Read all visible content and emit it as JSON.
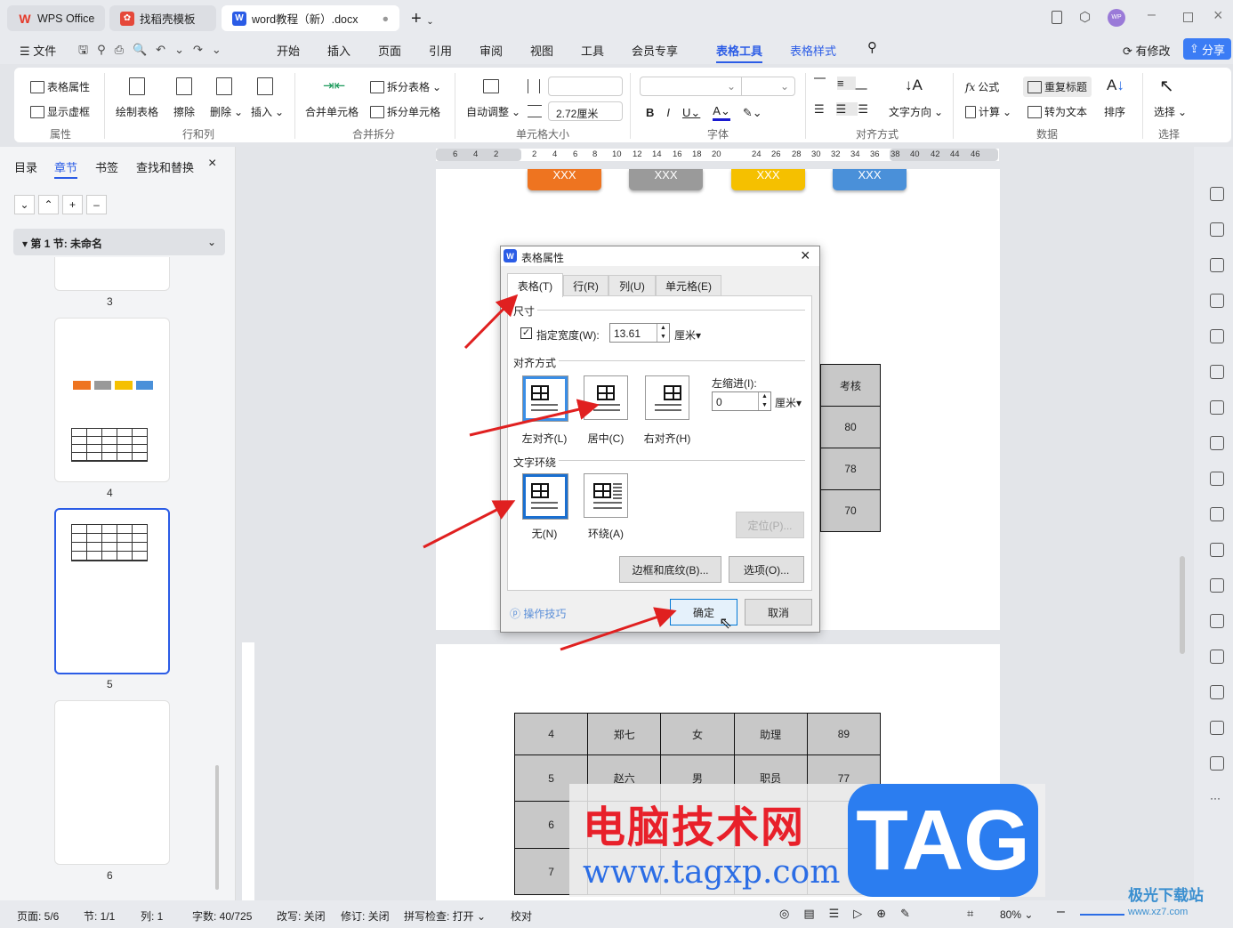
{
  "tabs": [
    {
      "label": "WPS Office"
    },
    {
      "label": "找稻壳模板"
    },
    {
      "label": "word教程（新）.docx"
    }
  ],
  "menu": {
    "file": "文件",
    "items": [
      "开始",
      "插入",
      "页面",
      "引用",
      "审阅",
      "视图",
      "工具",
      "会员专享",
      "表格工具",
      "表格样式"
    ],
    "active": "表格工具",
    "modified": "有修改",
    "share": "分享",
    "avatar": "WP"
  },
  "ribbon": {
    "table_props": "表格属性",
    "show_grid": "显示虚框",
    "group_props": "属性",
    "draw_table": "绘制表格",
    "erase": "擦除",
    "delete": "删除",
    "insert": "插入",
    "group_rowcol": "行和列",
    "merge_cells": "合并单元格",
    "split_table": "拆分表格",
    "split_cells": "拆分单元格",
    "group_merge": "合并拆分",
    "auto_fit": "自动调整",
    "width_value": "",
    "height_value": "2.72厘米",
    "group_cellsize": "单元格大小",
    "group_font": "字体",
    "text_dir": "文字方向",
    "group_align": "对齐方式",
    "formula": "公式",
    "repeat_title": "重复标题",
    "calc": "计算",
    "to_text": "转为文本",
    "sort": "排序",
    "group_data": "数据",
    "select": "选择",
    "group_select": "选择"
  },
  "nav": {
    "tabs": [
      "目录",
      "章节",
      "书签",
      "查找和替换"
    ],
    "active": "章节",
    "section": "第 1 节: 未命名",
    "pages": [
      "3",
      "4",
      "5",
      "6"
    ]
  },
  "ruler": [
    "6",
    "4",
    "2",
    "2",
    "4",
    "6",
    "8",
    "10",
    "12",
    "14",
    "16",
    "18",
    "20",
    "24",
    "26",
    "28",
    "30",
    "32",
    "34",
    "36",
    "38",
    "40",
    "42",
    "44",
    "46"
  ],
  "flow_boxes": [
    {
      "label": "XXX",
      "color": "#ee7420"
    },
    {
      "label": "XXX",
      "color": "#9a9a9a"
    },
    {
      "label": "XXX",
      "color": "#f5c000"
    },
    {
      "label": "XXX",
      "color": "#4a90d9"
    }
  ],
  "table_page1": [
    "考核",
    "80",
    "78",
    "70"
  ],
  "table_page2": [
    [
      "4",
      "郑七",
      "女",
      "助理",
      "89"
    ],
    [
      "5",
      "赵六",
      "男",
      "职员",
      "77"
    ],
    [
      "6",
      "",
      "",
      "",
      ""
    ],
    [
      "7",
      "",
      "",
      "",
      ""
    ]
  ],
  "dialog": {
    "title": "表格属性",
    "tabs": [
      "表格(T)",
      "行(R)",
      "列(U)",
      "单元格(E)"
    ],
    "size_section": "尺寸",
    "width_check": "指定宽度(W):",
    "width_checked": true,
    "width_value": "13.61",
    "unit": "厘米",
    "align_section": "对齐方式",
    "align_options": [
      "左对齐(L)",
      "居中(C)",
      "右对齐(H)"
    ],
    "align_selected": "左对齐(L)",
    "indent_label": "左缩进(I):",
    "indent_value": "0",
    "wrap_section": "文字环绕",
    "wrap_options": [
      "无(N)",
      "环绕(A)"
    ],
    "wrap_selected": "无(N)",
    "position_btn": "定位(P)...",
    "borders_btn": "边框和底纹(B)...",
    "options_btn": "选项(O)...",
    "tips": "操作技巧",
    "ok": "确定",
    "cancel": "取消"
  },
  "status": {
    "page": "页面: 5/6",
    "section": "节: 1/1",
    "col": "列: 1",
    "words": "字数: 40/725",
    "overwrite": "改写: 关闭",
    "revise": "修订: 关闭",
    "spell": "拼写检查: 打开",
    "proof": "校对",
    "zoom": "80%"
  },
  "watermark": {
    "cn": "电脑技术网",
    "url": "www.tagxp.com",
    "tag": "TAG",
    "corner": "极光下载站",
    "corner_url": "www.xz7.com"
  },
  "colors": {
    "accent": "#2b6de5",
    "arrow": "#e02020"
  }
}
